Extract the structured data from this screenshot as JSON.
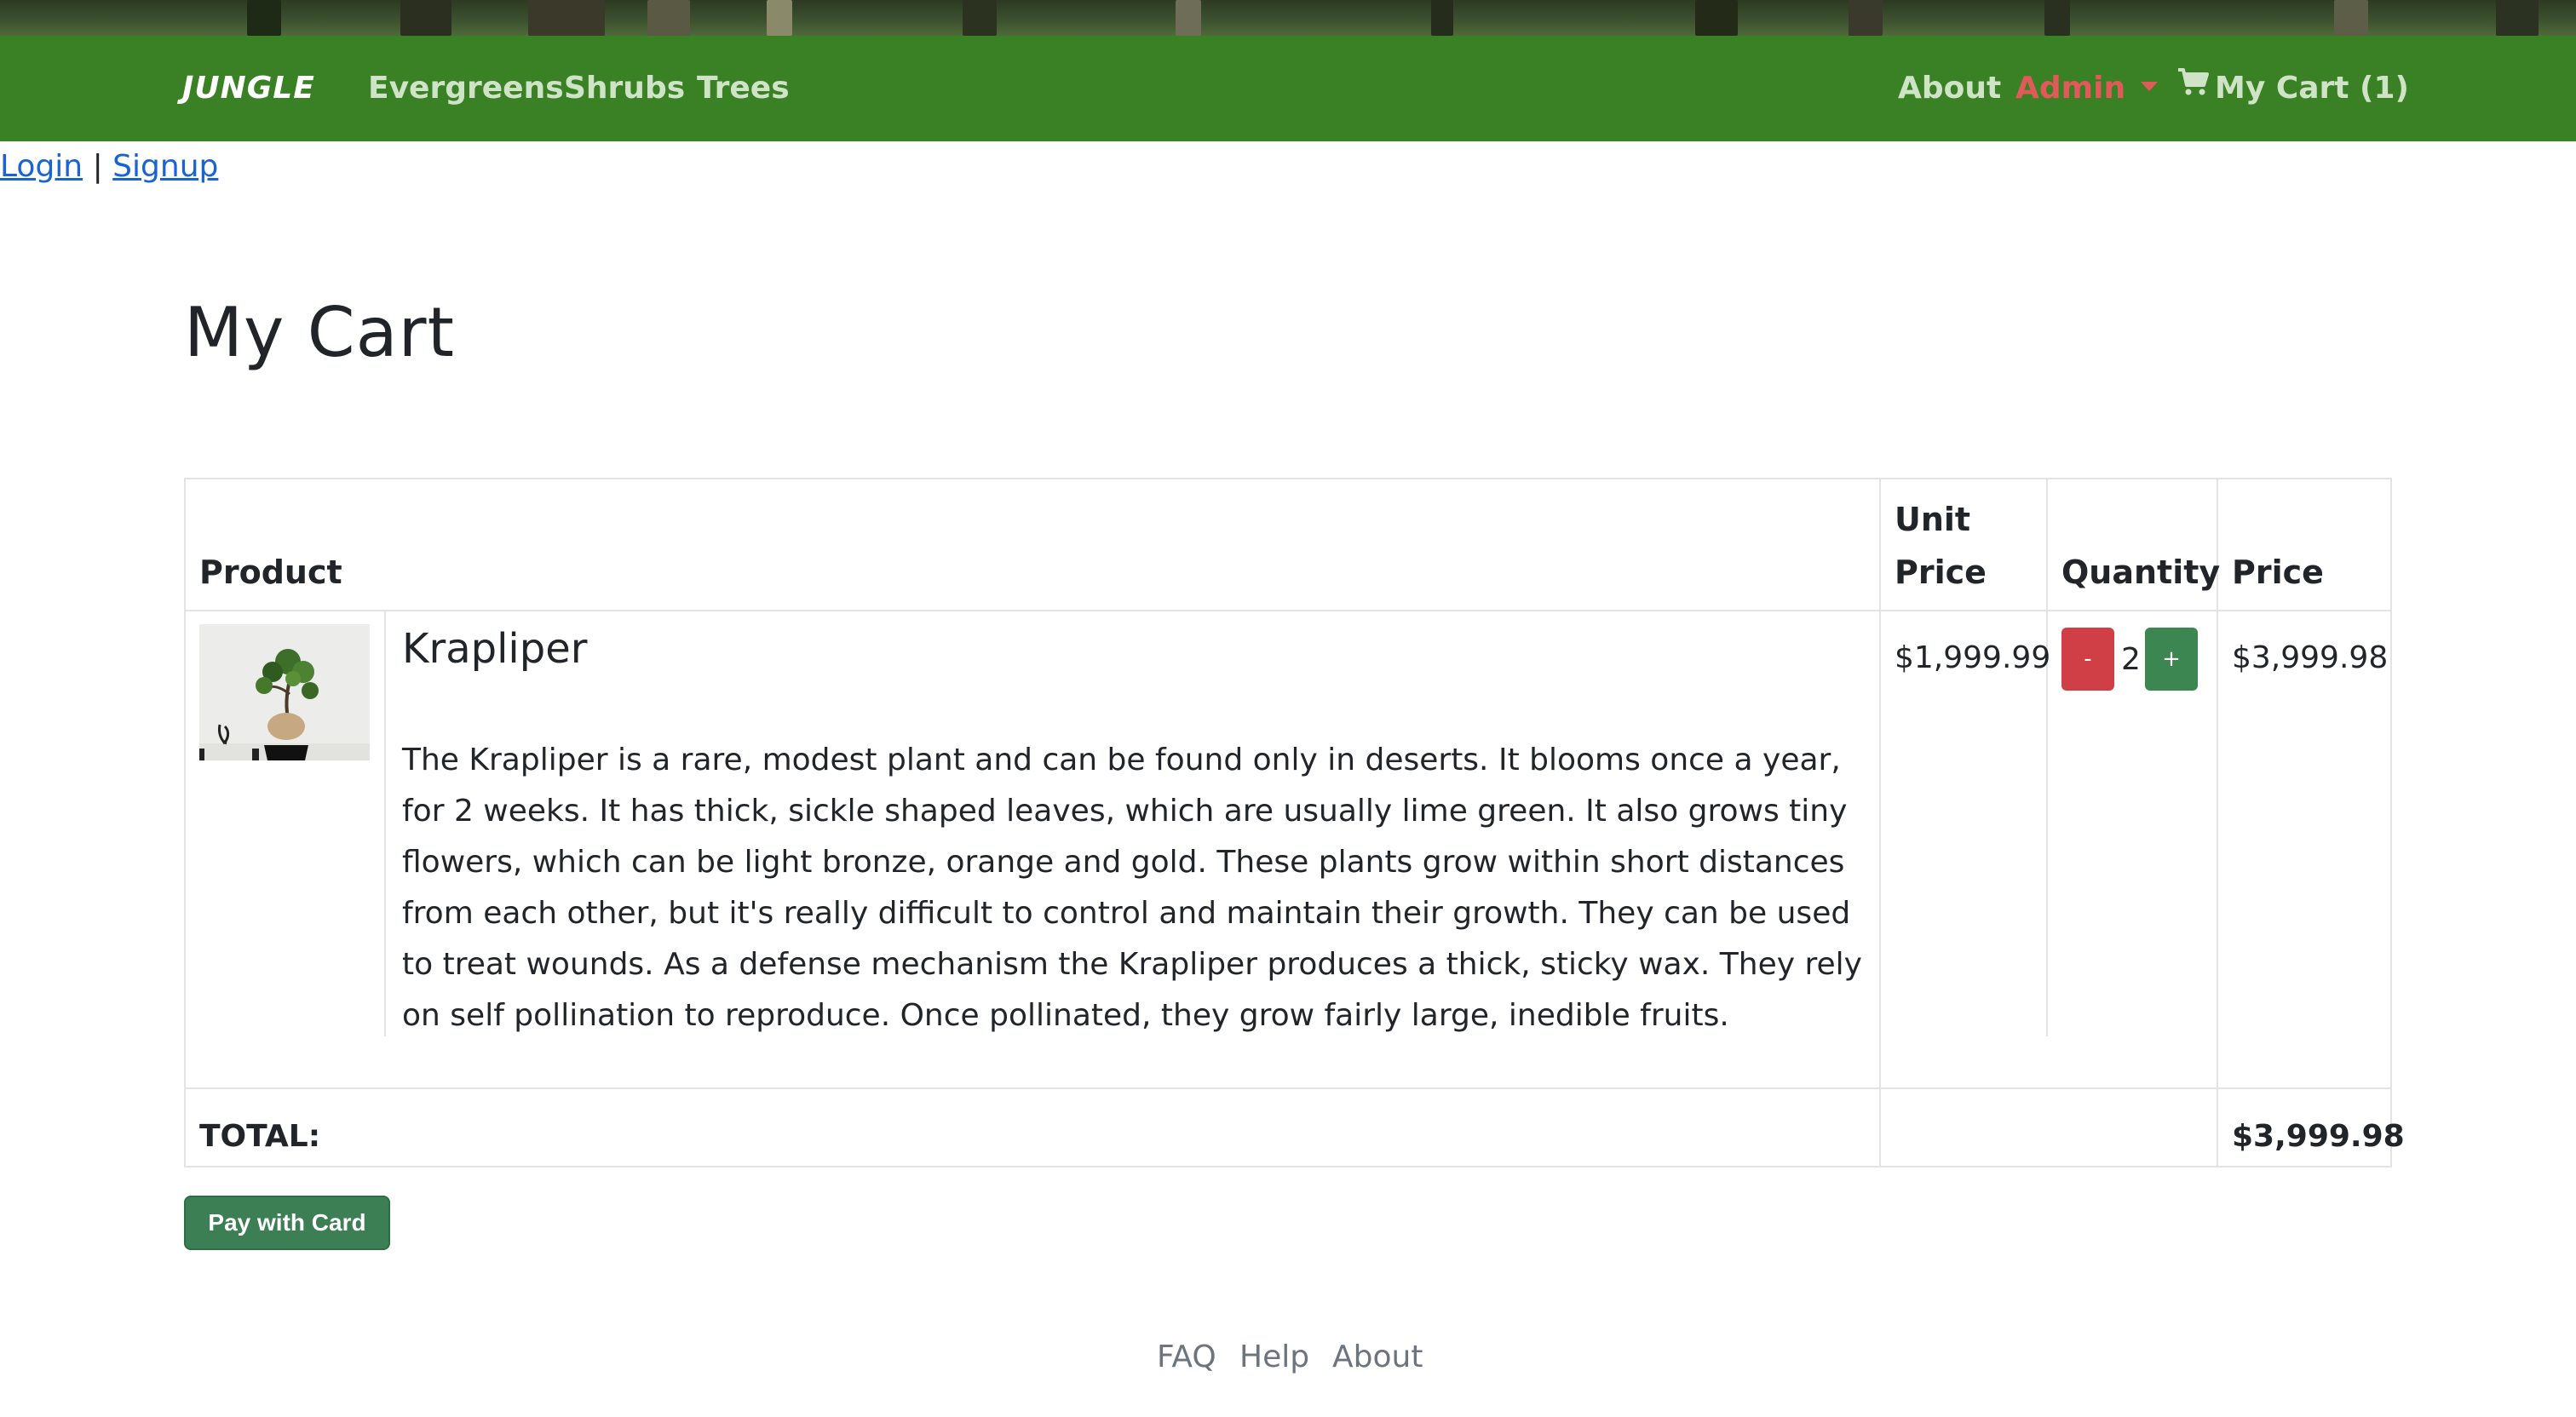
{
  "navbar": {
    "brand": "JUNGLE",
    "links": [
      "Evergreens",
      "Shrubs",
      "Trees"
    ],
    "about": "About",
    "admin": "Admin",
    "cart": "My Cart (1)"
  },
  "auth": {
    "login": "Login",
    "separator": "|",
    "signup": "Signup"
  },
  "page": {
    "title": "My Cart"
  },
  "table": {
    "headers": {
      "product": "Product",
      "unit_price_line1": "Unit",
      "unit_price_line2": "Price",
      "quantity": "Quantity",
      "price": "Price"
    },
    "rows": [
      {
        "name": "Krapliper",
        "description": "The Krapliper is a rare, modest plant and can be found only in deserts. It blooms once a year, for 2 weeks. It has thick, sickle shaped leaves, which are usually lime green. It also grows tiny flowers, which can be light bronze, orange and gold. These plants grow within short distances from each other, but it's really difficult to control and maintain their growth. They can be used to treat wounds. As a defense mechanism the Krapliper produces a thick, sticky wax. They rely on self pollination to reproduce. Once pollinated, they grow fairly large, inedible fruits.",
        "unit_price": "$1,999.99",
        "quantity": "2",
        "minus_label": "-",
        "plus_label": "+",
        "price": "$3,999.98"
      }
    ],
    "total_label": "TOTAL:",
    "total_value": "$3,999.98"
  },
  "actions": {
    "pay_label": "Pay with Card"
  },
  "footer": {
    "links": [
      "FAQ",
      "Help",
      "About"
    ]
  },
  "colors": {
    "navbar": "#3a8024",
    "admin": "#e05a5a",
    "minus": "#d03f45",
    "plus": "#3c8652",
    "pay": "#3c7f54",
    "link": "#1a63d6"
  }
}
